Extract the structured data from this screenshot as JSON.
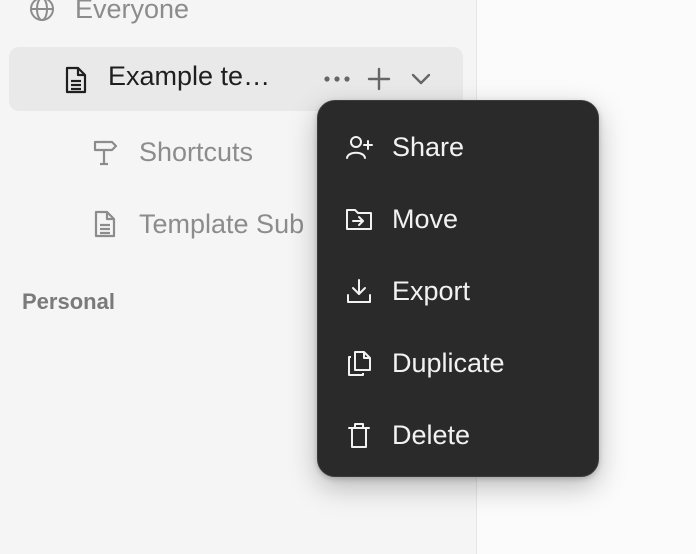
{
  "sidebar": {
    "everyone_label": "Everyone",
    "selected_item": {
      "title": "Example te…",
      "more_icon": "more-horizontal-icon",
      "add_icon": "plus-icon",
      "expand_icon": "chevron-down-icon"
    },
    "children": [
      {
        "label": "Shortcuts",
        "icon": "signpost-icon"
      },
      {
        "label": "Template Sub",
        "icon": "document-icon"
      }
    ],
    "section_personal": "Personal"
  },
  "context_menu": {
    "items": [
      {
        "label": "Share",
        "icon": "user-plus-icon"
      },
      {
        "label": "Move",
        "icon": "folder-move-icon"
      },
      {
        "label": "Export",
        "icon": "download-icon"
      },
      {
        "label": "Duplicate",
        "icon": "copy-icon"
      },
      {
        "label": "Delete",
        "icon": "trash-icon"
      }
    ]
  },
  "colors": {
    "sidebar_bg": "#f5f5f5",
    "selected_bg": "#e9e9e9",
    "menu_bg": "#2a2a2a",
    "menu_text": "#f2f2f2",
    "muted_text": "#8c8c8c"
  }
}
